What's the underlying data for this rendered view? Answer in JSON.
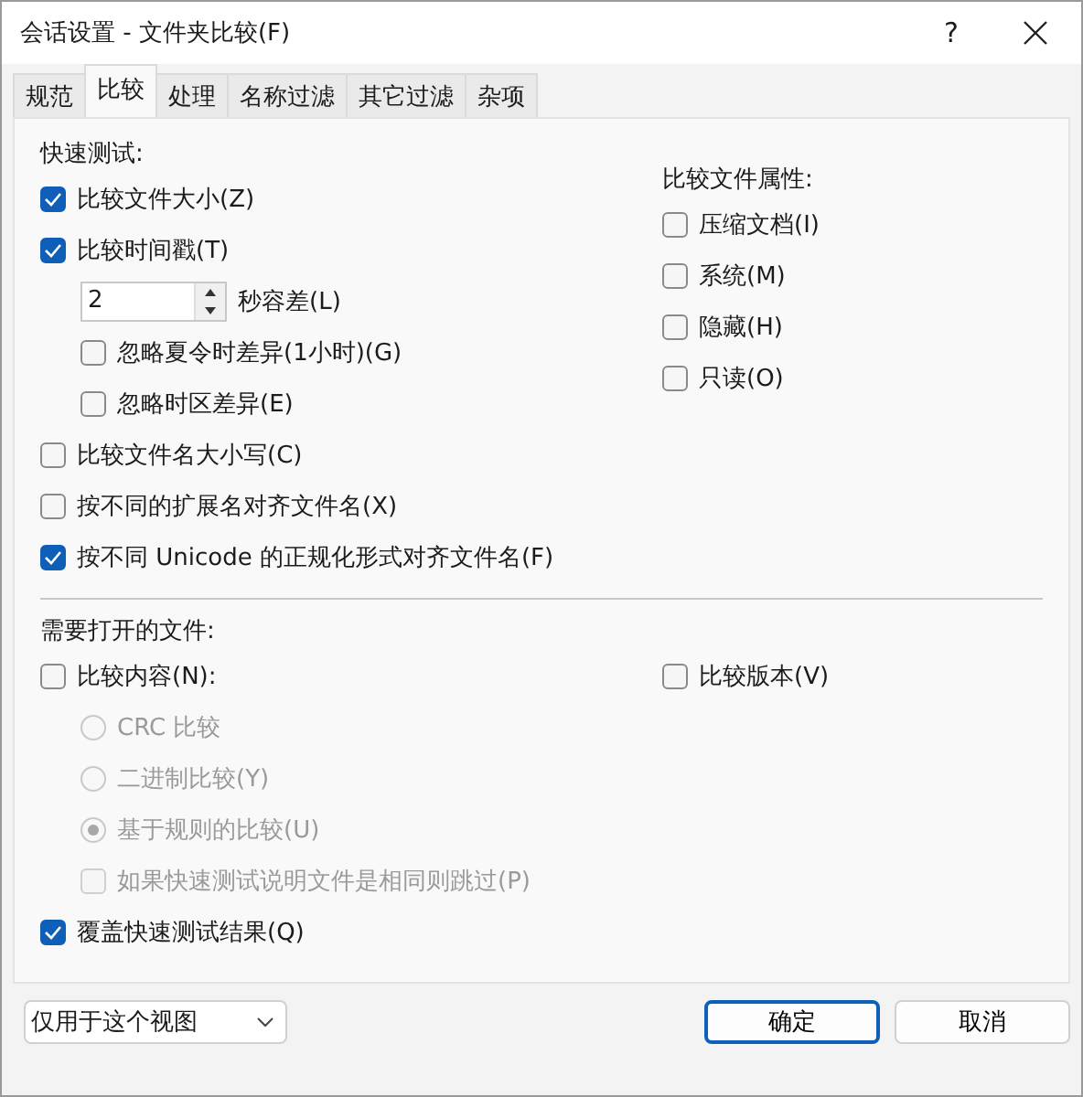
{
  "window": {
    "title": "会话设置 - 文件夹比较(F)",
    "help": "?"
  },
  "tabs": [
    {
      "label": "规范",
      "selected": false
    },
    {
      "label": "比较",
      "selected": true
    },
    {
      "label": "处理",
      "selected": false
    },
    {
      "label": "名称过滤",
      "selected": false
    },
    {
      "label": "其它过滤",
      "selected": false
    },
    {
      "label": "杂项",
      "selected": false
    }
  ],
  "quick_test": {
    "heading": "快速测试:",
    "items": [
      {
        "kind": "checkbox",
        "label": "比较文件大小(Z)",
        "checked": true,
        "disabled": false
      },
      {
        "kind": "checkbox",
        "label": "比较时间戳(T)",
        "checked": true,
        "disabled": false,
        "children": [
          {
            "kind": "spinner",
            "value": "2",
            "unit": "秒容差(L)"
          },
          {
            "kind": "checkbox",
            "label": "忽略夏令时差异(1小时)(G)",
            "checked": false,
            "disabled": false
          },
          {
            "kind": "checkbox",
            "label": "忽略时区差异(E)",
            "checked": false,
            "disabled": false
          }
        ]
      },
      {
        "kind": "checkbox",
        "label": "比较文件名大小写(C)",
        "checked": false,
        "disabled": false
      },
      {
        "kind": "checkbox",
        "label": "按不同的扩展名对齐文件名(X)",
        "checked": false,
        "disabled": false
      },
      {
        "kind": "checkbox",
        "label": "按不同 Unicode 的正规化形式对齐文件名(F)",
        "checked": true,
        "disabled": false
      }
    ]
  },
  "attributes": {
    "heading": "比较文件属性:",
    "items": [
      {
        "kind": "checkbox",
        "label": "压缩文档(I)",
        "checked": false,
        "disabled": false
      },
      {
        "kind": "checkbox",
        "label": "系统(M)",
        "checked": false,
        "disabled": false
      },
      {
        "kind": "checkbox",
        "label": "隐藏(H)",
        "checked": false,
        "disabled": false
      },
      {
        "kind": "checkbox",
        "label": "只读(O)",
        "checked": false,
        "disabled": false
      }
    ]
  },
  "open_files": {
    "heading": "需要打开的文件:",
    "items": [
      {
        "kind": "checkbox",
        "label": "比较内容(N):",
        "checked": false,
        "disabled": false,
        "children": [
          {
            "kind": "radio",
            "label": "CRC 比较",
            "selected": false,
            "disabled": true
          },
          {
            "kind": "radio",
            "label": "二进制比较(Y)",
            "selected": false,
            "disabled": true
          },
          {
            "kind": "radio",
            "label": "基于规则的比较(U)",
            "selected": true,
            "disabled": true
          },
          {
            "kind": "checkbox",
            "label": "如果快速测试说明文件是相同则跳过(P)",
            "checked": false,
            "disabled": true
          }
        ]
      },
      {
        "kind": "checkbox",
        "label": "覆盖快速测试结果(Q)",
        "checked": true,
        "disabled": false
      }
    ],
    "right_items": [
      {
        "kind": "checkbox",
        "label": "比较版本(V)",
        "checked": false,
        "disabled": false
      }
    ]
  },
  "footer": {
    "scope_dropdown": {
      "value": "仅用于这个视图"
    },
    "buttons": [
      {
        "label": "确定",
        "default": true
      },
      {
        "label": "取消",
        "default": false
      }
    ]
  }
}
